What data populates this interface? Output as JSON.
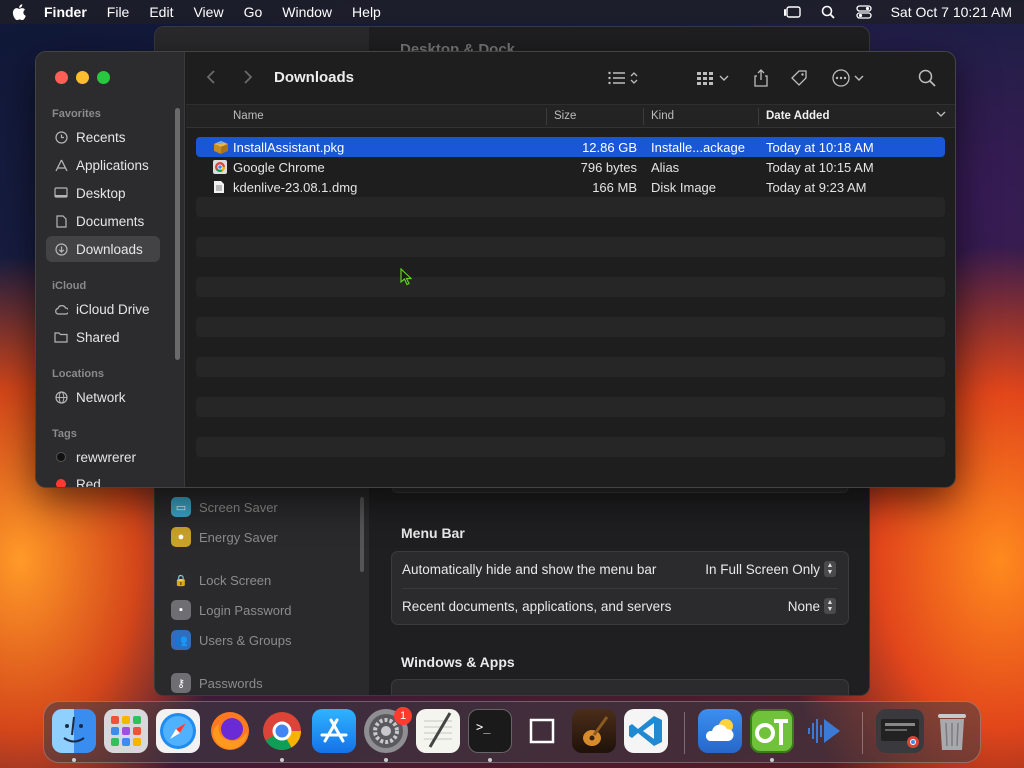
{
  "menubar": {
    "app_name": "Finder",
    "items": [
      "File",
      "Edit",
      "View",
      "Go",
      "Window",
      "Help"
    ],
    "clock": "Sat Oct 7  10:21 AM"
  },
  "settings": {
    "title": "Desktop & Dock",
    "sidebar": [
      {
        "label": "Screen Saver",
        "icon": "screen-saver-icon",
        "color": "#3ca6c8"
      },
      {
        "label": "Energy Saver",
        "icon": "energy-saver-icon",
        "color": "#f5c542"
      },
      {
        "label": "Lock Screen",
        "icon": "lock-icon",
        "color": "#2c2c2e"
      },
      {
        "label": "Login Password",
        "icon": "login-password-icon",
        "color": "#8e8e93"
      },
      {
        "label": "Users & Groups",
        "icon": "users-icon",
        "color": "#2f7dd6"
      },
      {
        "label": "Passwords",
        "icon": "key-icon",
        "color": "#8e8e93"
      }
    ],
    "menu_bar_title": "Menu Bar",
    "menu_bar_rows": [
      {
        "label": "Automatically hide and show the menu bar",
        "value": "In Full Screen Only"
      },
      {
        "label": "Recent documents, applications, and servers",
        "value": "None"
      }
    ],
    "windows_apps_title": "Windows & Apps"
  },
  "finder": {
    "title": "Downloads",
    "sidebar": {
      "favorites_head": "Favorites",
      "favorites": [
        {
          "label": "Recents",
          "icon": "clock-icon"
        },
        {
          "label": "Applications",
          "icon": "applications-icon"
        },
        {
          "label": "Desktop",
          "icon": "desktop-icon"
        },
        {
          "label": "Documents",
          "icon": "document-icon"
        },
        {
          "label": "Downloads",
          "icon": "downloads-icon",
          "active": true
        }
      ],
      "icloud_head": "iCloud",
      "icloud": [
        {
          "label": "iCloud Drive",
          "icon": "cloud-icon"
        },
        {
          "label": "Shared",
          "icon": "shared-folder-icon"
        }
      ],
      "locations_head": "Locations",
      "locations": [
        {
          "label": "Network",
          "icon": "globe-icon"
        }
      ],
      "tags_head": "Tags",
      "tags": [
        {
          "label": "rewwrerer",
          "color": "#111111"
        },
        {
          "label": "Red",
          "color": "#ff3b30"
        }
      ]
    },
    "columns": {
      "name": "Name",
      "size": "Size",
      "kind": "Kind",
      "date_added": "Date Added"
    },
    "files": [
      {
        "name": "InstallAssistant.pkg",
        "size": "12.86 GB",
        "kind": "Installe...ackage",
        "date": "Today at 10:18 AM",
        "icon": "package-icon",
        "selected": true
      },
      {
        "name": "Google Chrome",
        "size": "796 bytes",
        "kind": "Alias",
        "date": "Today at 10:15 AM",
        "icon": "chrome-alias-icon",
        "selected": false
      },
      {
        "name": "kdenlive-23.08.1.dmg",
        "size": "166 MB",
        "kind": "Disk Image",
        "date": "Today at 9:23 AM",
        "icon": "disk-image-icon",
        "selected": false
      }
    ]
  },
  "dock": {
    "settings_badge": "1",
    "apps": [
      "finder",
      "launchpad",
      "safari",
      "firefox",
      "chrome",
      "app-store",
      "system-settings",
      "textedit",
      "terminal",
      "preview-window",
      "garageband",
      "vscode",
      "weather",
      "opentoonz",
      "audio-app",
      "downloads-stack",
      "trash"
    ]
  }
}
